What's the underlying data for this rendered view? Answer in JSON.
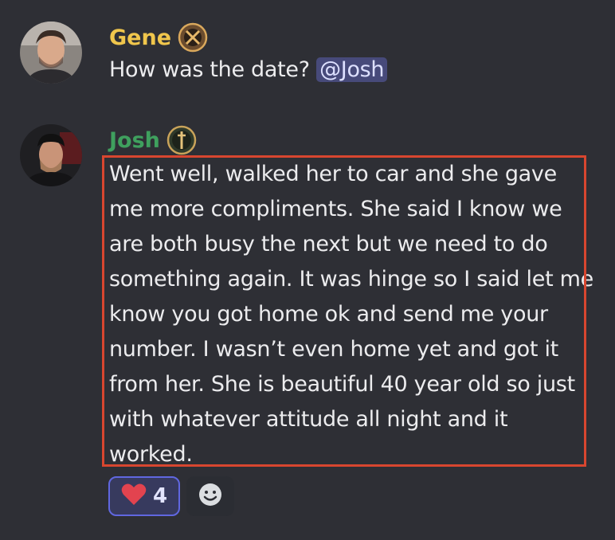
{
  "messages": [
    {
      "author": "Gene",
      "author_color": "#f0c64c",
      "avatar": "avatar-photo",
      "role_icon": "crossed-swords-badge-icon",
      "text": "How was the date?",
      "mention": "@Josh"
    },
    {
      "author": "Josh",
      "author_color": "#3fa05e",
      "avatar": "avatar-photo",
      "role_icon": "sword-badge-icon",
      "lines": [
        "Went well, walked her to car and she gave",
        "me more compliments. She said I know we",
        "are  both busy the next but we need to do",
        "something again. It was hinge so I said let me",
        "know you got home ok and send me your",
        "number. I wasn’t even home yet and got it",
        "from her.  She is beautiful 40 year old so just",
        "with whatever attitude all night and it",
        "worked."
      ]
    }
  ],
  "reactions": [
    {
      "emoji": "heart-icon",
      "count": "4"
    },
    {
      "emoji": "add-reaction-smiley-icon"
    }
  ],
  "colors": {
    "background": "#2e2f35",
    "highlight_border": "#d8462f",
    "mention_bg": "#474a7a",
    "reaction_selected_border": "#6067e0"
  }
}
